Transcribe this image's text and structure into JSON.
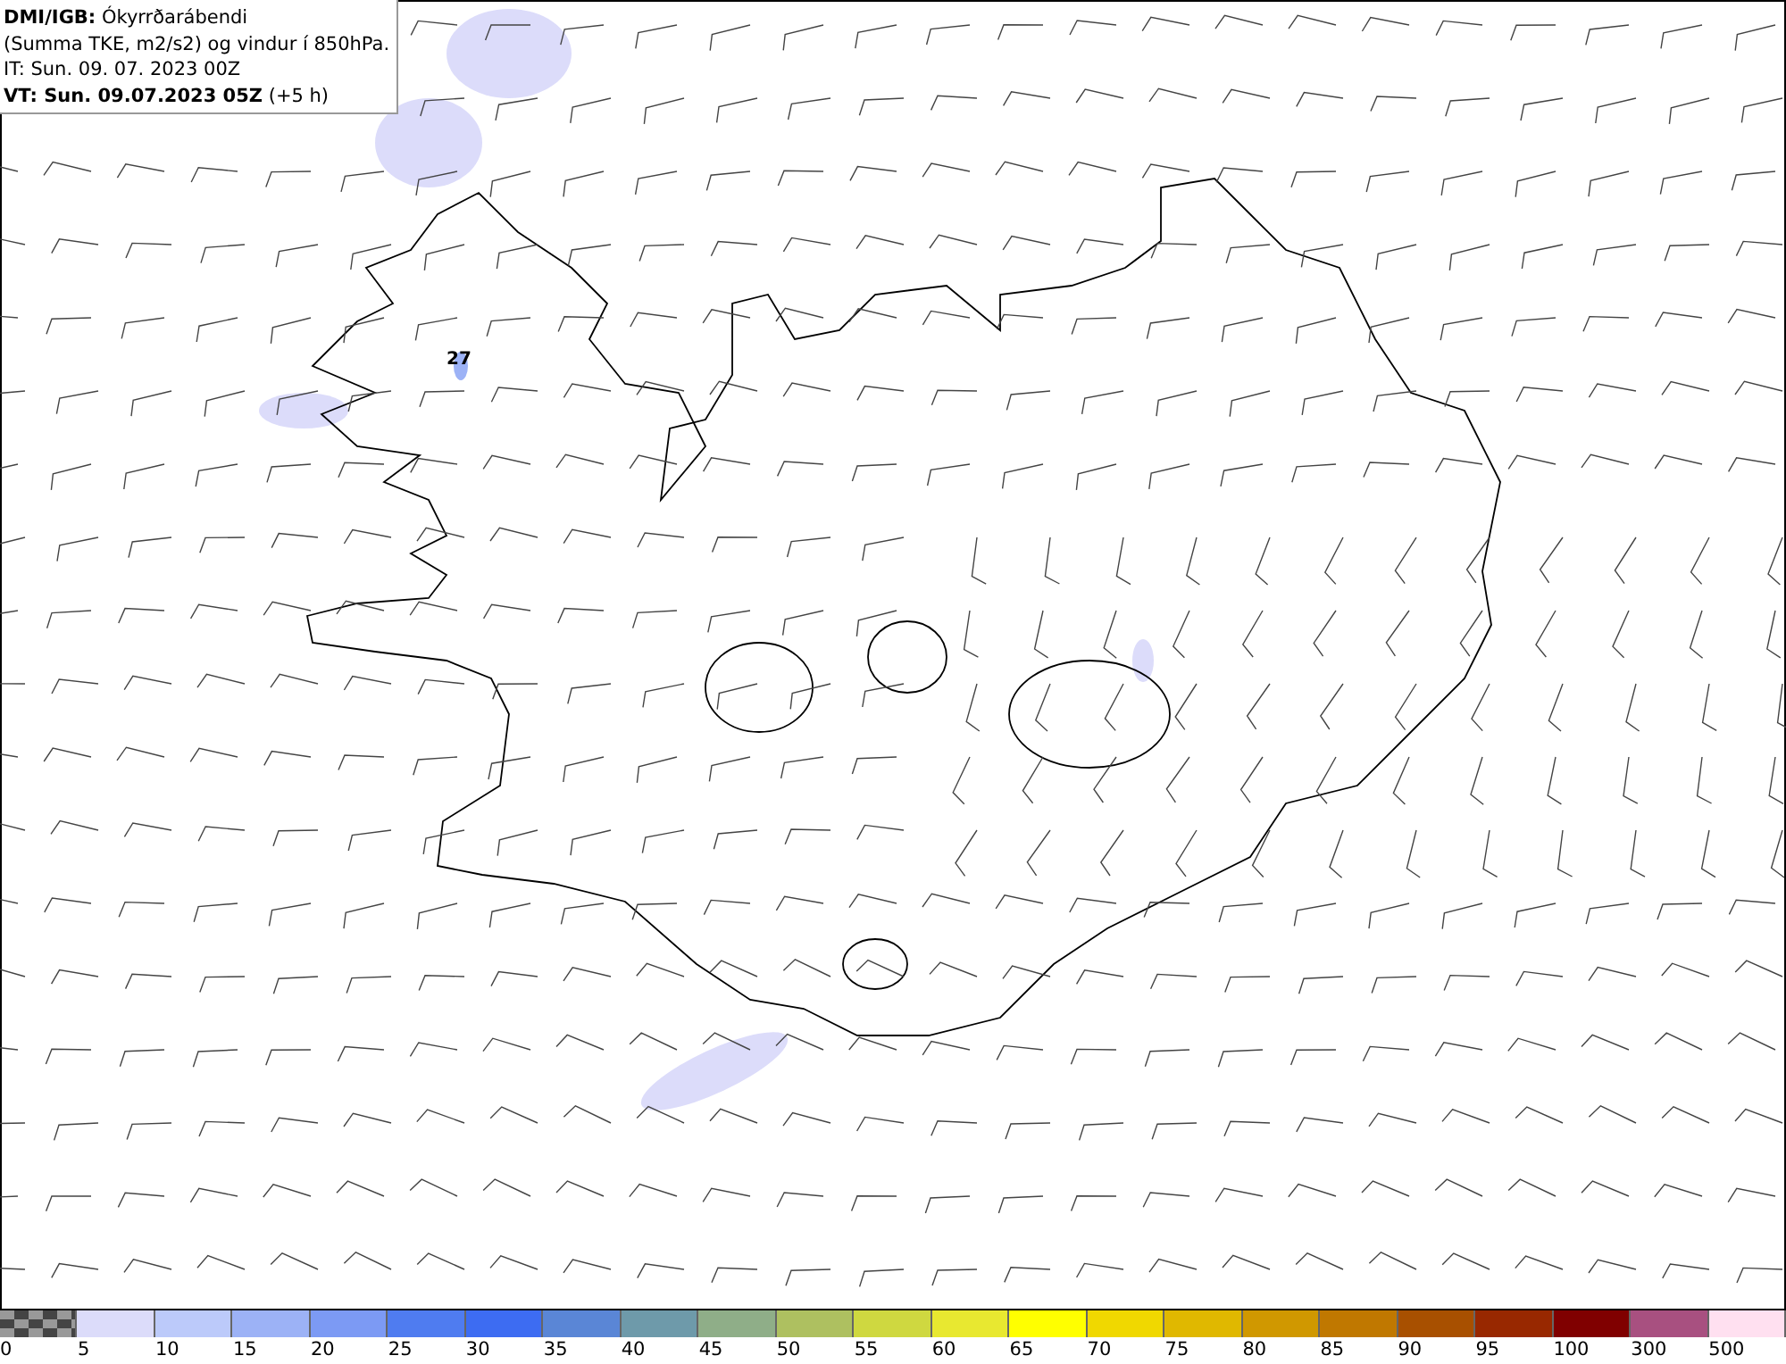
{
  "title_box": {
    "lines": [
      "**DMI/IGB:** Ókyrrðarábendi",
      "(Summa TKE, m2/s2) og vindur í 850hPa.",
      "IT: Sun. 09. 07. 2023 00Z",
      "**VT: Sun. 09.07.2023 05Z** (+5 h)"
    ]
  },
  "map": {
    "value_label": "27"
  },
  "legend": [
    {
      "label": "0",
      "kind": "checker"
    },
    {
      "label": "5",
      "color": "#dcdcfa"
    },
    {
      "label": "10",
      "color": "#bccafa"
    },
    {
      "label": "15",
      "color": "#9cb2f6"
    },
    {
      "label": "20",
      "color": "#7c9af4"
    },
    {
      "label": "25",
      "color": "#4f7cf0"
    },
    {
      "label": "30",
      "color": "#3d6cf2"
    },
    {
      "label": "35",
      "color": "#5a86d6"
    },
    {
      "label": "40",
      "color": "#6e9aaa"
    },
    {
      "label": "45",
      "color": "#8fae88"
    },
    {
      "label": "50",
      "color": "#aec060"
    },
    {
      "label": "55",
      "color": "#cfd840"
    },
    {
      "label": "60",
      "color": "#e8e830"
    },
    {
      "label": "65",
      "color": "#ffff00"
    },
    {
      "label": "70",
      "color": "#f0d800"
    },
    {
      "label": "75",
      "color": "#e0b800"
    },
    {
      "label": "80",
      "color": "#d09800"
    },
    {
      "label": "85",
      "color": "#c07800"
    },
    {
      "label": "90",
      "color": "#a85000"
    },
    {
      "label": "95",
      "color": "#982800"
    },
    {
      "label": "100",
      "color": "#800000"
    },
    {
      "label": "300",
      "color": "#a85080"
    },
    {
      "label": "500",
      "color": "#ffe0f0"
    }
  ]
}
